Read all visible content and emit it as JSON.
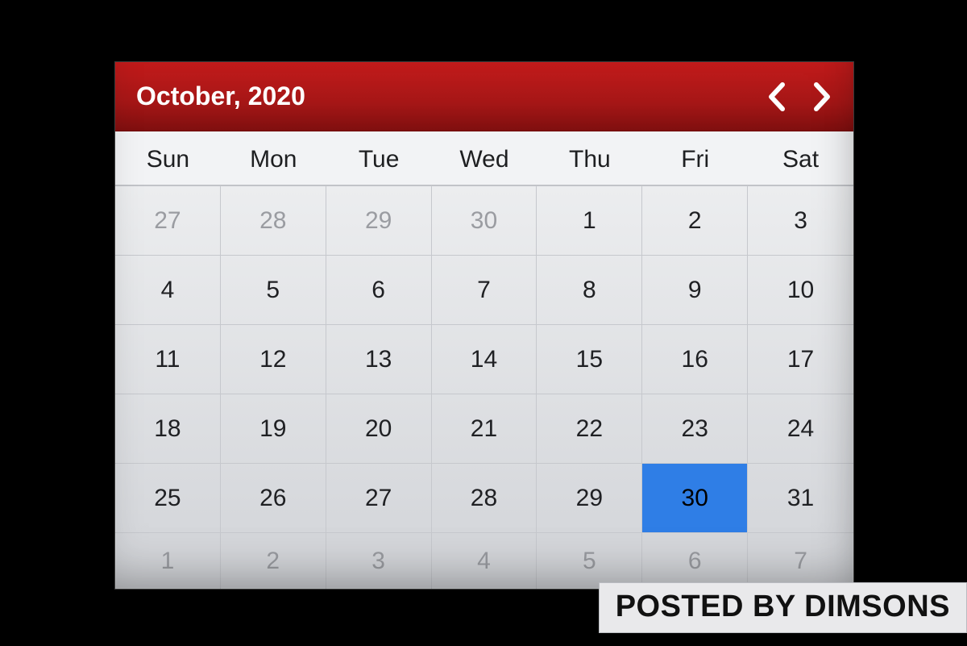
{
  "header": {
    "title": "October, 2020"
  },
  "weekdays": [
    "Sun",
    "Mon",
    "Tue",
    "Wed",
    "Thu",
    "Fri",
    "Sat"
  ],
  "weeks": [
    {
      "c": [
        {
          "n": "27",
          "o": true
        },
        {
          "n": "28",
          "o": true
        },
        {
          "n": "29",
          "o": true
        },
        {
          "n": "30",
          "o": true
        },
        {
          "n": "1"
        },
        {
          "n": "2"
        },
        {
          "n": "3"
        }
      ]
    },
    {
      "c": [
        {
          "n": "4"
        },
        {
          "n": "5"
        },
        {
          "n": "6"
        },
        {
          "n": "7"
        },
        {
          "n": "8"
        },
        {
          "n": "9"
        },
        {
          "n": "10"
        }
      ]
    },
    {
      "c": [
        {
          "n": "11"
        },
        {
          "n": "12"
        },
        {
          "n": "13"
        },
        {
          "n": "14"
        },
        {
          "n": "15"
        },
        {
          "n": "16"
        },
        {
          "n": "17"
        }
      ]
    },
    {
      "c": [
        {
          "n": "18"
        },
        {
          "n": "19"
        },
        {
          "n": "20"
        },
        {
          "n": "21"
        },
        {
          "n": "22"
        },
        {
          "n": "23"
        },
        {
          "n": "24"
        }
      ]
    },
    {
      "c": [
        {
          "n": "25"
        },
        {
          "n": "26"
        },
        {
          "n": "27"
        },
        {
          "n": "28"
        },
        {
          "n": "29"
        },
        {
          "n": "30",
          "s": true
        },
        {
          "n": "31"
        }
      ]
    },
    {
      "c": [
        {
          "n": "1",
          "o": true
        },
        {
          "n": "2",
          "o": true
        },
        {
          "n": "3",
          "o": true
        },
        {
          "n": "4",
          "o": true
        },
        {
          "n": "5",
          "o": true
        },
        {
          "n": "6",
          "o": true
        },
        {
          "n": "7",
          "o": true
        }
      ]
    }
  ],
  "watermark": "POSTED BY DIMSONS",
  "colors": {
    "header": "#a51616",
    "selected": "#2f7ee6"
  }
}
